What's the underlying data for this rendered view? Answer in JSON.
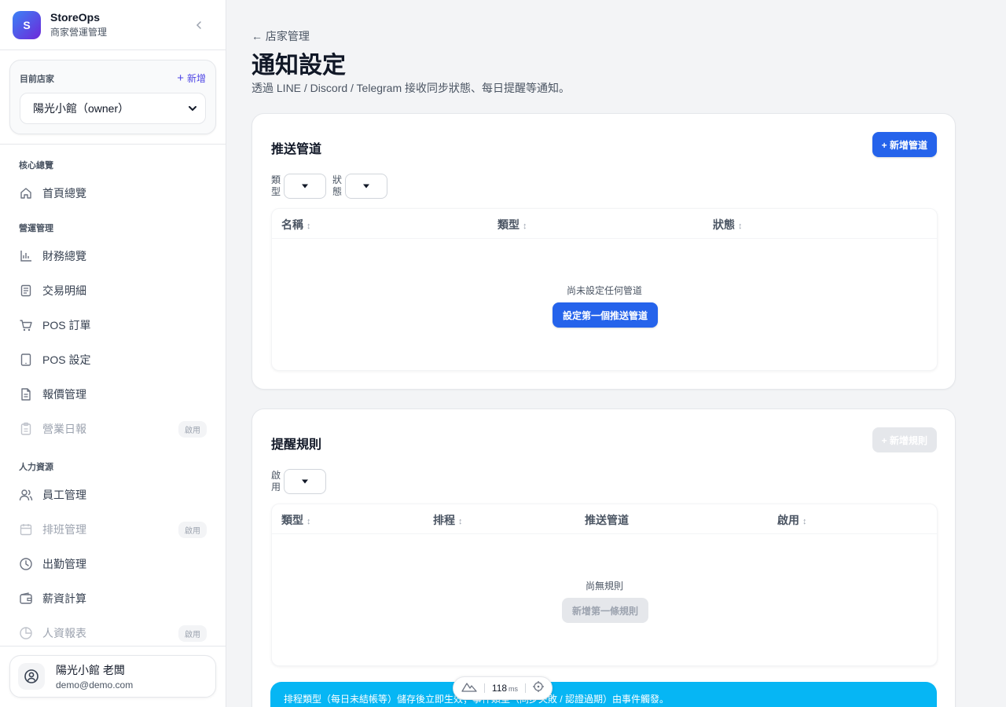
{
  "brand": {
    "logo_letter": "S",
    "name": "StoreOps",
    "subtitle": "商家營運管理"
  },
  "store": {
    "label": "目前店家",
    "add_label": "新增",
    "selected": "陽光小館（owner）"
  },
  "nav": {
    "sections": [
      {
        "title": "核心總覽",
        "items": [
          {
            "label": "首頁總覽",
            "icon": "home-icon",
            "disabled": false
          }
        ]
      },
      {
        "title": "營運管理",
        "items": [
          {
            "label": "財務總覽",
            "icon": "bar-chart-icon",
            "disabled": false
          },
          {
            "label": "交易明細",
            "icon": "receipt-icon",
            "disabled": false
          },
          {
            "label": "POS 訂單",
            "icon": "cart-icon",
            "disabled": false
          },
          {
            "label": "POS 設定",
            "icon": "tablet-icon",
            "disabled": false
          },
          {
            "label": "報價管理",
            "icon": "document-icon",
            "disabled": false
          },
          {
            "label": "營業日報",
            "icon": "clipboard-icon",
            "disabled": true,
            "badge": "啟用"
          }
        ]
      },
      {
        "title": "人力資源",
        "items": [
          {
            "label": "員工管理",
            "icon": "users-icon",
            "disabled": false
          },
          {
            "label": "排班管理",
            "icon": "calendar-icon",
            "disabled": true,
            "badge": "啟用"
          },
          {
            "label": "出勤管理",
            "icon": "clock-icon",
            "disabled": false
          },
          {
            "label": "薪資計算",
            "icon": "wallet-icon",
            "disabled": false
          },
          {
            "label": "人資報表",
            "icon": "pie-chart-icon",
            "disabled": true,
            "badge": "啟用"
          }
        ]
      }
    ]
  },
  "user": {
    "name": "陽光小館 老闆",
    "email": "demo@demo.com"
  },
  "header": {
    "back_label": "← 店家管理",
    "title": "通知設定",
    "description": "透過 LINE / Discord / Telegram 接收同步狀態、每日提醒等通知。"
  },
  "channels": {
    "title": "推送管道",
    "add_button": "+ 新增管道",
    "filters": [
      {
        "label": "類型"
      },
      {
        "label": "狀態"
      }
    ],
    "columns": [
      {
        "label": "名稱",
        "sortable": true
      },
      {
        "label": "類型",
        "sortable": true
      },
      {
        "label": "狀態",
        "sortable": true
      }
    ],
    "empty_text": "尚未設定任何管道",
    "empty_button": "設定第一個推送管道"
  },
  "rules": {
    "title": "提醒規則",
    "add_button": "+ 新增規則",
    "filters": [
      {
        "label": "啟用"
      }
    ],
    "columns": [
      {
        "label": "類型",
        "sortable": true
      },
      {
        "label": "排程",
        "sortable": true
      },
      {
        "label": "推送管道",
        "sortable": false
      },
      {
        "label": "啟用",
        "sortable": true
      }
    ],
    "empty_text": "尚無規則",
    "empty_button": "新增第一條規則"
  },
  "banner": {
    "text": "排程類型（每日未結帳等）儲存後立即生效；事件類型（同步失敗 / 認證過期）由事件觸發。"
  },
  "perf": {
    "value": "118",
    "unit": "ms"
  },
  "sort_glyph": "↕",
  "colors": {
    "primary": "#2563eb",
    "brand_from": "#3b82f6",
    "brand_to": "#6d28d9",
    "banner": "#06b6f4",
    "link_accent": "#4f46e5"
  }
}
